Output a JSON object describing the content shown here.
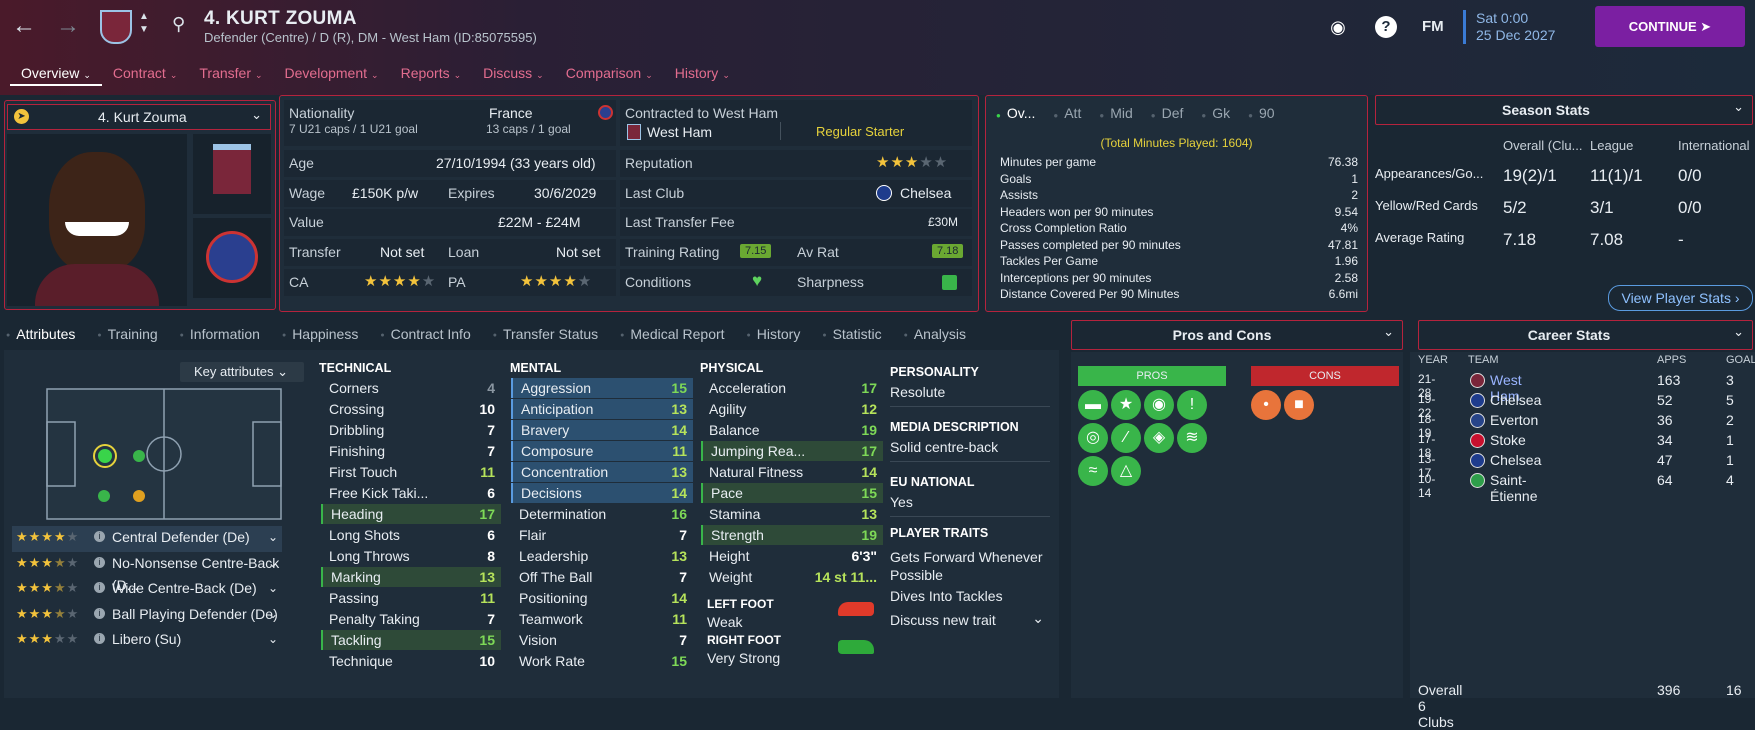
{
  "header": {
    "player_title": "4. KURT ZOUMA",
    "player_subtitle": "Defender (Centre) / D (R), DM - West Ham (ID:85075595)",
    "date_line1": "Sat 0:00",
    "date_line2": "25 Dec 2027",
    "continue_label": "CONTINUE",
    "fm_label": "FM",
    "help_label": "?"
  },
  "tabs": [
    "Overview",
    "Contract",
    "Transfer",
    "Development",
    "Reports",
    "Discuss",
    "Comparison",
    "History"
  ],
  "player_select": "4. Kurt Zouma",
  "profile": {
    "nationality_label": "Nationality",
    "nationality": "France",
    "u21_caps": "7 U21 caps / 1 U21 goal",
    "caps": "13 caps / 1 goal",
    "contracted_label": "Contracted to West Ham",
    "club": "West Ham",
    "role": "Regular Starter",
    "age_label": "Age",
    "age": "27/10/1994 (33 years old)",
    "wage_label": "Wage",
    "wage": "£150K p/w",
    "expires_label": "Expires",
    "expires": "30/6/2029",
    "value_label": "Value",
    "value": "£22M - £24M",
    "transfer_label": "Transfer",
    "transfer": "Not set",
    "loan_label": "Loan",
    "loan": "Not set",
    "ca_label": "CA",
    "pa_label": "PA",
    "reputation_label": "Reputation",
    "last_club_label": "Last Club",
    "last_club": "Chelsea",
    "last_fee_label": "Last Transfer Fee",
    "last_fee": "£30M",
    "training_label": "Training Rating",
    "training": "7.15",
    "avrat_label": "Av Rat",
    "avrat": "7.18",
    "conditions_label": "Conditions",
    "sharpness_label": "Sharpness"
  },
  "stats_tabs": [
    "Ov...",
    "Att",
    "Mid",
    "Def",
    "Gk",
    "90"
  ],
  "stats_summary": "(Total Minutes Played: 1604)",
  "stats": [
    [
      "Minutes per game",
      "76.38"
    ],
    [
      "Goals",
      "1"
    ],
    [
      "Assists",
      "2"
    ],
    [
      "Headers won per 90 minutes",
      "9.54"
    ],
    [
      "Cross Completion Ratio",
      "4%"
    ],
    [
      "Passes completed per 90 minutes",
      "47.81"
    ],
    [
      "Tackles Per Game",
      "1.96"
    ],
    [
      "Interceptions per 90 minutes",
      "2.58"
    ],
    [
      "Distance Covered Per 90 Minutes",
      "6.6mi"
    ]
  ],
  "season": {
    "title": "Season Stats",
    "cols": [
      "Overall (Clu...",
      "League",
      "International"
    ],
    "rows": [
      [
        "Appearances/Go...",
        "19(2)/1",
        "11(1)/1",
        "0/0"
      ],
      [
        "Yellow/Red Cards",
        "5/2",
        "3/1",
        "0/0"
      ],
      [
        "Average Rating",
        "7.18",
        "7.08",
        "-"
      ]
    ],
    "button": "View Player Stats"
  },
  "subtabs": [
    "Attributes",
    "Training",
    "Information",
    "Happiness",
    "Contract Info",
    "Transfer Status",
    "Medical Report",
    "History",
    "Statistic",
    "Analysis"
  ],
  "key_attr_label": "Key attributes",
  "roles": [
    {
      "name": "Central Defender (De)",
      "stars": 4
    },
    {
      "name": "No-Nonsense Centre-Back (D...",
      "stars": 3.5
    },
    {
      "name": "Wide Centre-Back (De)",
      "stars": 3.5
    },
    {
      "name": "Ball Playing Defender (De)",
      "stars": 3.5
    },
    {
      "name": "Libero (Su)",
      "stars": 3
    }
  ],
  "technical_title": "TECHNICAL",
  "technical": [
    [
      "Corners",
      "4"
    ],
    [
      "Crossing",
      "10"
    ],
    [
      "Dribbling",
      "7"
    ],
    [
      "Finishing",
      "7"
    ],
    [
      "First Touch",
      "11"
    ],
    [
      "Free Kick Taki...",
      "6"
    ],
    [
      "Heading",
      "17"
    ],
    [
      "Long Shots",
      "6"
    ],
    [
      "Long Throws",
      "8"
    ],
    [
      "Marking",
      "13"
    ],
    [
      "Passing",
      "11"
    ],
    [
      "Penalty Taking",
      "7"
    ],
    [
      "Tackling",
      "15"
    ],
    [
      "Technique",
      "10"
    ]
  ],
  "mental_title": "MENTAL",
  "mental": [
    [
      "Aggression",
      "15"
    ],
    [
      "Anticipation",
      "13"
    ],
    [
      "Bravery",
      "14"
    ],
    [
      "Composure",
      "11"
    ],
    [
      "Concentration",
      "13"
    ],
    [
      "Decisions",
      "14"
    ],
    [
      "Determination",
      "16"
    ],
    [
      "Flair",
      "7"
    ],
    [
      "Leadership",
      "13"
    ],
    [
      "Off The Ball",
      "7"
    ],
    [
      "Positioning",
      "14"
    ],
    [
      "Teamwork",
      "11"
    ],
    [
      "Vision",
      "7"
    ],
    [
      "Work Rate",
      "15"
    ]
  ],
  "physical_title": "PHYSICAL",
  "physical": [
    [
      "Acceleration",
      "17"
    ],
    [
      "Agility",
      "12"
    ],
    [
      "Balance",
      "19"
    ],
    [
      "Jumping Rea...",
      "17"
    ],
    [
      "Natural Fitness",
      "14"
    ],
    [
      "Pace",
      "15"
    ],
    [
      "Stamina",
      "13"
    ],
    [
      "Strength",
      "19"
    ],
    [
      "Height",
      "6'3\""
    ],
    [
      "Weight",
      "14 st 11..."
    ]
  ],
  "left_foot_label": "LEFT FOOT",
  "left_foot": "Weak",
  "right_foot_label": "RIGHT FOOT",
  "right_foot": "Very Strong",
  "personality_label": "PERSONALITY",
  "personality": "Resolute",
  "media_label": "MEDIA DESCRIPTION",
  "media": "Solid centre-back",
  "eu_label": "EU NATIONAL",
  "eu": "Yes",
  "traits_label": "PLAYER TRAITS",
  "trait1": "Gets Forward Whenever Possible",
  "trait2": "Dives Into Tackles",
  "trait_add": "Discuss new trait",
  "pros_cons_title": "Pros and Cons",
  "pros_label": "PROS",
  "cons_label": "CONS",
  "career": {
    "title": "Career Stats",
    "cols": [
      "YEAR",
      "TEAM",
      "APPS",
      "GOALS"
    ],
    "rows": [
      [
        "21-28",
        "West Ham",
        "163",
        "3"
      ],
      [
        "19-22",
        "Chelsea",
        "52",
        "5"
      ],
      [
        "18-19",
        "Everton",
        "36",
        "2"
      ],
      [
        "17-18",
        "Stoke",
        "34",
        "1"
      ],
      [
        "13-17",
        "Chelsea",
        "47",
        "1"
      ],
      [
        "10-14",
        "Saint-Étienne",
        "64",
        "4"
      ]
    ],
    "total_label": "Overall 6 Clubs",
    "total_apps": "396",
    "total_goals": "16"
  }
}
